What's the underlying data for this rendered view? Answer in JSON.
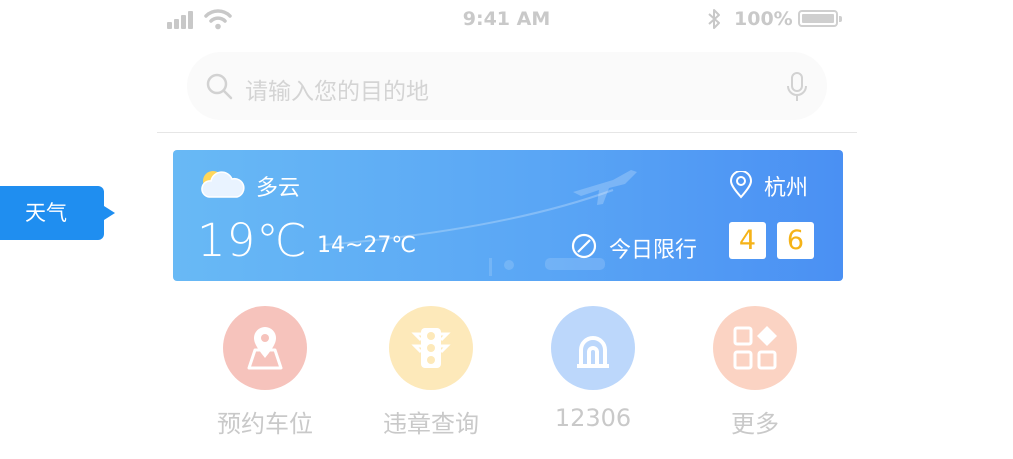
{
  "status_bar": {
    "time": "9:41 AM",
    "battery_percent": "100%",
    "icons": [
      "signal-icon",
      "wifi-icon",
      "bluetooth-icon",
      "battery-icon"
    ]
  },
  "search": {
    "placeholder": "请输入您的目的地",
    "icons": [
      "search-icon",
      "microphone-icon"
    ]
  },
  "weather": {
    "condition": "多云",
    "temperature": "19℃",
    "range": "14~27℃",
    "city": "杭州",
    "limit_label": "今日限行",
    "plates": [
      "4",
      "6"
    ],
    "colors": {
      "card_start": "#68b9f5",
      "card_end": "#4a90f3",
      "plate_text": "#f5b318"
    }
  },
  "callout": {
    "label": "天气",
    "color": "#1f8ef0"
  },
  "quick_entries": [
    {
      "label": "预约车位",
      "icon": "map-pin-icon",
      "color": "#f6c3bc"
    },
    {
      "label": "违章查询",
      "icon": "traffic-light-icon",
      "color": "#fde9ba"
    },
    {
      "label": "12306",
      "icon": "railway-logo-icon",
      "color": "#bcd7fb"
    },
    {
      "label": "更多",
      "icon": "more-grid-icon",
      "color": "#fbd3c3"
    }
  ]
}
